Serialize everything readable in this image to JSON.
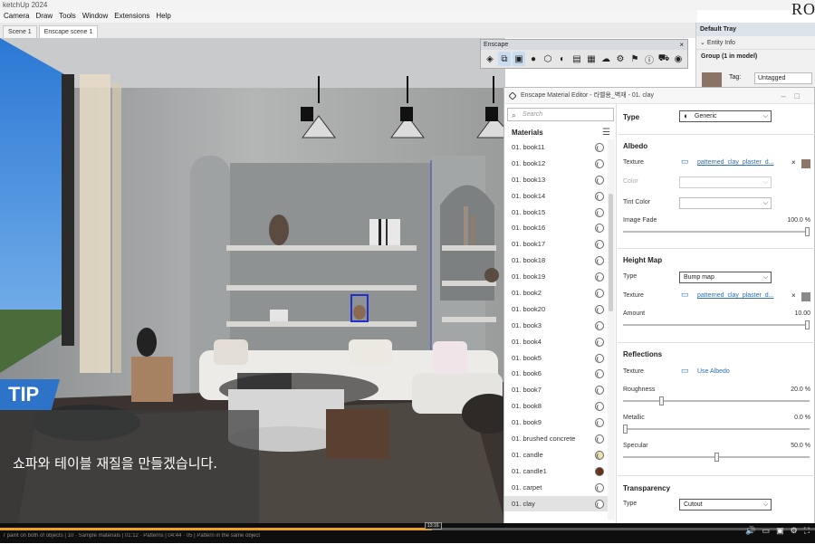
{
  "app": {
    "title": "ketchUp 2024",
    "brand": "RO"
  },
  "menubar": [
    "Camera",
    "Draw",
    "Tools",
    "Window",
    "Extensions",
    "Help"
  ],
  "scenes": [
    "Scene 1",
    "Enscape scene 1"
  ],
  "enscape_toolbar": {
    "title": "Enscape",
    "close": "×",
    "icons": [
      "enscape-logo-icon",
      "live-update-icon",
      "sync-views-icon",
      "capture-icon",
      "asset-library-icon",
      "material-editor-icon",
      "render-icon",
      "panorama-icon",
      "upload-icon",
      "settings-icon",
      "feedback-icon",
      "info-icon",
      "store-icon",
      "account-icon"
    ]
  },
  "default_tray": {
    "title": "Default Tray",
    "entity_info": "Entity Info",
    "group": "Group (1 in model)",
    "tag_label": "Tag:",
    "tag_value": "Untagged",
    "swatch_color": "#8a7466"
  },
  "material_editor": {
    "title": "Enscape Material Editor - 라벨용_벽재 - 01. clay",
    "search_placeholder": "Search",
    "materials_header": "Materials",
    "materials": [
      {
        "name": "01. book11",
        "color": "#ffffff"
      },
      {
        "name": "01. book12",
        "color": "#ffffff"
      },
      {
        "name": "01. book13",
        "color": "#ffffff"
      },
      {
        "name": "01. book14",
        "color": "#ffffff"
      },
      {
        "name": "01. book15",
        "color": "#ffffff"
      },
      {
        "name": "01. book16",
        "color": "#ffffff"
      },
      {
        "name": "01. book17",
        "color": "#ffffff"
      },
      {
        "name": "01. book18",
        "color": "#ffffff"
      },
      {
        "name": "01. book19",
        "color": "#ffffff"
      },
      {
        "name": "01. book2",
        "color": "#ffffff"
      },
      {
        "name": "01. book20",
        "color": "#ffffff"
      },
      {
        "name": "01. book3",
        "color": "#ffffff"
      },
      {
        "name": "01. book4",
        "color": "#ffffff"
      },
      {
        "name": "01. book5",
        "color": "#ffffff"
      },
      {
        "name": "01. book6",
        "color": "#ffffff"
      },
      {
        "name": "01. book7",
        "color": "#ffffff"
      },
      {
        "name": "01. book8",
        "color": "#ffffff"
      },
      {
        "name": "01. book9",
        "color": "#ffffff"
      },
      {
        "name": "01. brushed concrete",
        "color": "#ffffff"
      },
      {
        "name": "01. candle",
        "color": "#e9e2b0"
      },
      {
        "name": "01. candle1",
        "color": "#6b2e14"
      },
      {
        "name": "01. carpet",
        "color": "#ffffff"
      },
      {
        "name": "01. clay",
        "color": "#ffffff"
      }
    ],
    "selected_material": "01. clay",
    "type_label": "Type",
    "type_value": "Generic",
    "albedo": {
      "header": "Albedo",
      "texture_label": "Texture",
      "texture_file": "patterned_clay_plaster_d...",
      "texture_color": "#8d7568",
      "remove": "×",
      "color_label": "Color",
      "tint_label": "Tint Color",
      "fade_label": "Image Fade",
      "fade_value": "100.0 %",
      "fade": 1.0
    },
    "height_map": {
      "header": "Height Map",
      "type_label": "Type",
      "type_value": "Bump map",
      "texture_label": "Texture",
      "texture_file": "patterned_clay_plaster_d...",
      "texture_color": "#8a8a8a",
      "remove": "×",
      "amount_label": "Amount",
      "amount_value": "10.00",
      "amount": 1.0
    },
    "reflections": {
      "header": "Reflections",
      "texture_label": "Texture",
      "texture_value": "Use Albedo",
      "roughness_label": "Roughness",
      "roughness_value": "20.0 %",
      "roughness": 0.2,
      "metallic_label": "Metallic",
      "metallic_value": "0.0 %",
      "metallic": 0.0,
      "specular_label": "Specular",
      "specular_value": "50.0 %",
      "specular": 0.5
    },
    "transparency": {
      "header": "Transparency",
      "type_label": "Type",
      "type_value": "Cutout"
    }
  },
  "overlay": {
    "tip": "TIP",
    "subtitle": "쇼파와 테이블 재질을 만들겠습니다."
  },
  "player": {
    "timecode": "13:16",
    "progress": 0.53,
    "chapters": "r paint on both of objects | 10 · Sample materials | 01:12 · Patterns | 04:44 · 05 | Pattern in the same object"
  },
  "colors": {
    "accent": "#2d74c8",
    "progress": "#f0a020"
  }
}
